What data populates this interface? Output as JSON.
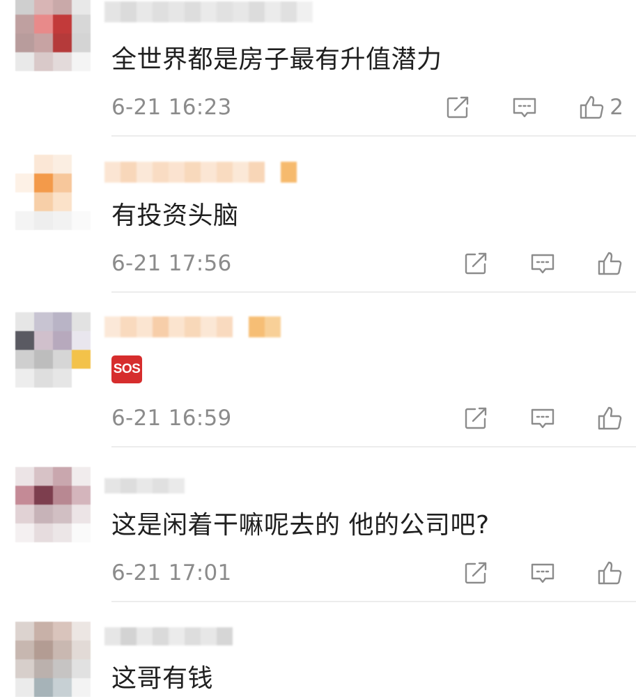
{
  "comments": [
    {
      "text": "全世界都是房子最有升值潜力",
      "time": "6-21 16:23",
      "like_count": "2"
    },
    {
      "text": "有投资头脑",
      "time": "6-21 17:56",
      "like_count": ""
    },
    {
      "emoji": "SOS",
      "time": "6-21 16:59",
      "like_count": ""
    },
    {
      "text": "这是闲着干嘛呢去的 他的公司吧?",
      "time": "6-21 17:01",
      "like_count": ""
    },
    {
      "text": "这哥有钱"
    }
  ],
  "icons": {
    "share": "share-icon",
    "reply": "comment-icon",
    "like": "thumbs-up-icon"
  },
  "colors": {
    "text": "#1f1f1f",
    "meta": "#8b8b8b",
    "divider": "#ececec",
    "sos_red": "#d62d2d"
  }
}
